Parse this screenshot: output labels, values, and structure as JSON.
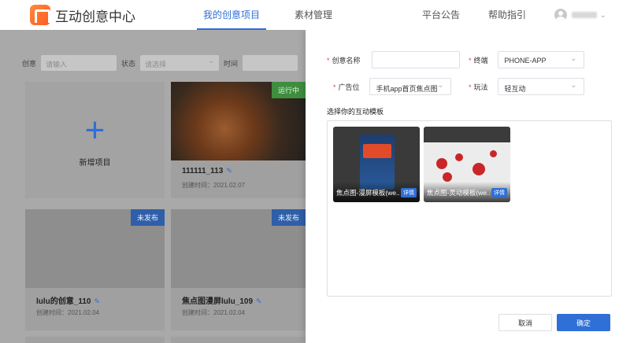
{
  "app": {
    "title": "互动创意中心"
  },
  "nav": {
    "items": [
      {
        "label": "我的创意项目",
        "active": true
      },
      {
        "label": "素材管理",
        "active": false
      }
    ],
    "right": [
      {
        "label": "平台公告"
      },
      {
        "label": "帮助指引"
      }
    ]
  },
  "filters": {
    "creative_label": "创意",
    "creative_placeholder": "请输入",
    "status_label": "状态",
    "status_placeholder": "请选择",
    "time_label": "时间"
  },
  "cards": [
    {
      "type": "new",
      "label": "新增项目"
    },
    {
      "title": "111111_113",
      "date": "创建时间：2021.02.07",
      "badge": "运行中"
    },
    {
      "title": "lulu的创意_110",
      "date": "创建时间：2021.02.04",
      "badge": "未发布"
    },
    {
      "title": "焦点图漫屏lulu_109",
      "date": "创建时间：2021.02.04",
      "badge": "未发布"
    }
  ],
  "drawer": {
    "name_label": "创意名称",
    "name_value": "",
    "terminal_label": "终端",
    "terminal_value": "PHONE-APP",
    "adpos_label": "广告位",
    "adpos_value": "手机app首页焦点图",
    "play_label": "玩法",
    "play_value": "轻互动",
    "section_title": "选择你的互动模板",
    "templates": [
      {
        "name": "焦点图-漫屏模板(we...",
        "detail": "详情"
      },
      {
        "name": "焦点图-灵动模板(we...",
        "detail": "详情"
      }
    ],
    "cancel_label": "取消",
    "ok_label": "确定"
  },
  "colors": {
    "accent": "#2f6fd6",
    "required": "#e2433a",
    "live": "#3e8e3e"
  }
}
